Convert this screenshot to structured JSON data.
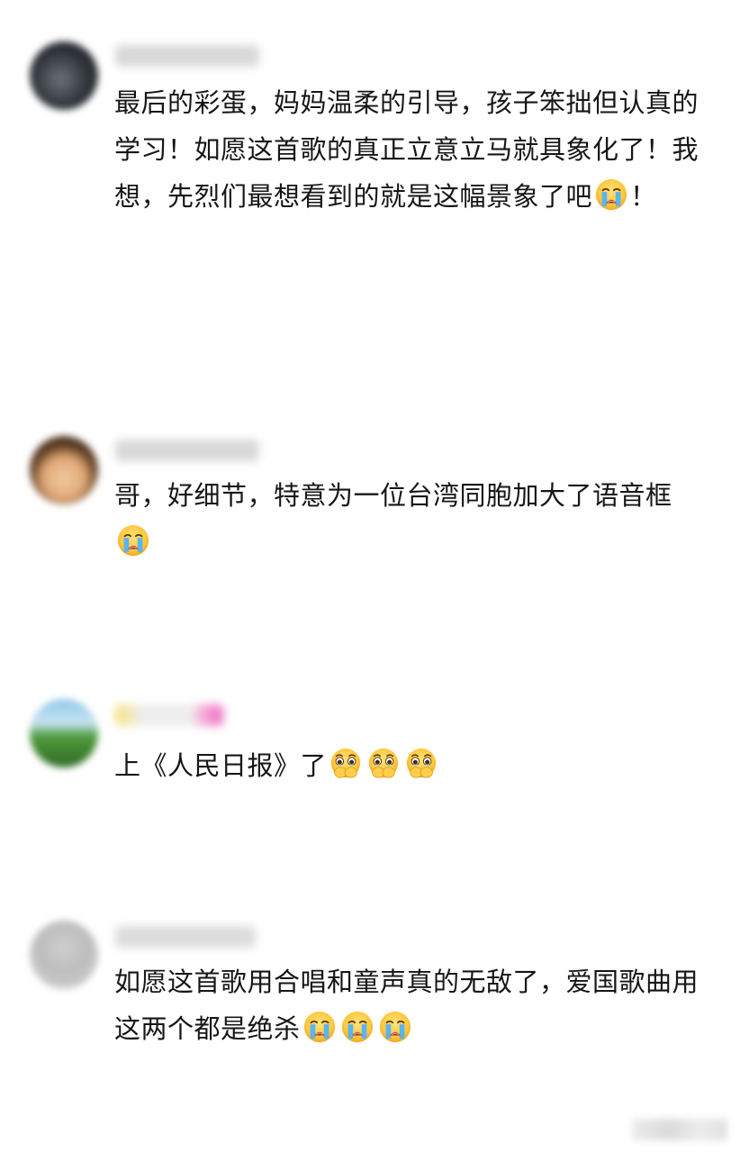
{
  "comments": [
    {
      "text": "最后的彩蛋，妈妈温柔的引导，孩子笨拙但认真的学习！如愿这首歌的真正立意立马就具象化了！我想，先烈们最想看到的就是这幅景象了吧",
      "suffix": "！",
      "emoji": [
        "loudly-crying-face"
      ]
    },
    {
      "text": "哥，好细节，特意为一位台湾同胞加大了语音框",
      "suffix": "",
      "emoji": [
        "loudly-crying-face"
      ]
    },
    {
      "text": "上《人民日报》了",
      "suffix": "",
      "emoji": [
        "face-holding-back-tears",
        "face-holding-back-tears",
        "face-holding-back-tears"
      ]
    },
    {
      "text": "如愿这首歌用合唱和童声真的无敌了，爱国歌曲用这两个都是绝杀",
      "suffix": "",
      "emoji": [
        "loudly-crying-face",
        "loudly-crying-face",
        "loudly-crying-face"
      ]
    }
  ]
}
